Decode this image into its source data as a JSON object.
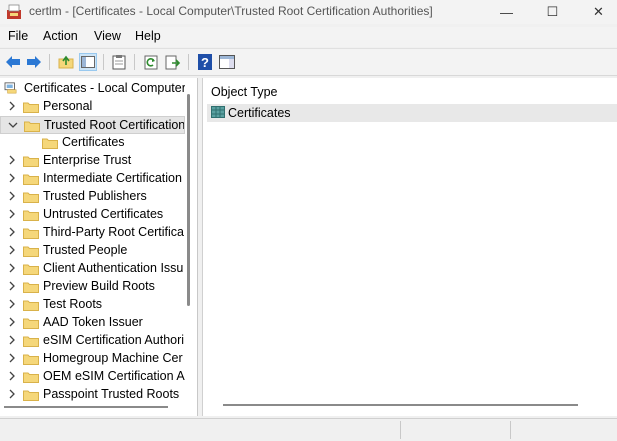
{
  "window": {
    "title": "certlm - [Certificates - Local Computer\\Trusted Root Certification Authorities]",
    "minimize_glyph": "—",
    "maximize_glyph": "☐",
    "close_glyph": "✕"
  },
  "menu": [
    "File",
    "Action",
    "View",
    "Help"
  ],
  "toolbar": {
    "buttons": [
      "back-arrow-icon",
      "forward-arrow-icon",
      "up-folder-icon",
      "show-hide-tree-icon",
      "clipboard-icon",
      "refresh-icon",
      "export-list-icon",
      "help-icon",
      "properties-pane-icon"
    ],
    "help_glyph": "?"
  },
  "tree": {
    "root_label": "Certificates - Local Computer",
    "items": [
      {
        "label": "Personal",
        "expanded": false
      },
      {
        "label": "Trusted Root Certification",
        "expanded": true,
        "selected": true
      },
      {
        "label": "Certificates",
        "child": true
      },
      {
        "label": "Enterprise Trust",
        "expanded": false
      },
      {
        "label": "Intermediate Certification",
        "expanded": false
      },
      {
        "label": "Trusted Publishers",
        "expanded": false
      },
      {
        "label": "Untrusted Certificates",
        "expanded": false
      },
      {
        "label": "Third-Party Root Certifica",
        "expanded": false
      },
      {
        "label": "Trusted People",
        "expanded": false
      },
      {
        "label": "Client Authentication Issu",
        "expanded": false
      },
      {
        "label": "Preview Build Roots",
        "expanded": false
      },
      {
        "label": "Test Roots",
        "expanded": false
      },
      {
        "label": "AAD Token Issuer",
        "expanded": false
      },
      {
        "label": "eSIM Certification Authori",
        "expanded": false
      },
      {
        "label": "Homegroup Machine Cer",
        "expanded": false
      },
      {
        "label": "OEM eSIM Certification Au",
        "expanded": false
      },
      {
        "label": "Passpoint Trusted Roots",
        "expanded": false
      }
    ]
  },
  "list": {
    "column_header": "Object Type",
    "rows": [
      "Certificates"
    ]
  },
  "colors": {
    "folder_fill": "#f5d77a",
    "folder_edge": "#d9b24a",
    "arrow_blue": "#2b78d4",
    "selection": "#e5e5e5"
  }
}
